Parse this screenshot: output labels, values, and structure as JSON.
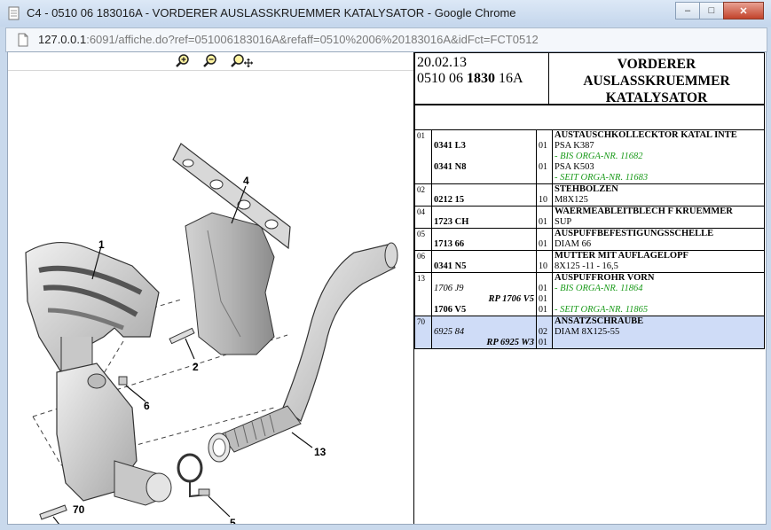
{
  "window": {
    "title": "C4 - 0510 06 183016A - VORDERER AUSLASSKRUEMMER KATALYSATOR - Google Chrome",
    "minimize_label": "–",
    "maximize_label": "□",
    "close_label": "✕"
  },
  "address": {
    "host": "127.0.0.1",
    "rest": ":6091/affiche.do?ref=051006183016A&refaff=0510%2006%20183016A&idFct=FCT0512"
  },
  "toolbar": {
    "icons": [
      "zoom-in-icon",
      "zoom-out-icon",
      "pan-zoom-icon"
    ]
  },
  "diagram": {
    "callouts": [
      "1",
      "2",
      "4",
      "5",
      "6",
      "13",
      "70"
    ]
  },
  "header": {
    "date": "20.02.13",
    "ref_prefix": "0510 06 ",
    "ref_bold": "1830",
    "ref_suffix": " 16A",
    "title_lines": [
      "VORDERER",
      "AUSLASSKRUEMMER",
      "KATALYSATOR"
    ]
  },
  "parts": [
    {
      "pos": "01",
      "refs": [
        "",
        "0341 L3",
        "",
        "0341 N8",
        ""
      ],
      "qtys": [
        "",
        "01",
        "",
        "01",
        ""
      ],
      "descs": [
        "AUSTAUSCHKOLLECKTOR KATAL INTE",
        "PSA K387",
        "- BIS ORGA-NR. 11682",
        "PSA K503",
        "- SEIT ORGA-NR. 11683"
      ]
    },
    {
      "pos": "02",
      "refs": [
        "",
        "0212 15"
      ],
      "qtys": [
        "",
        "10"
      ],
      "descs": [
        "STEHBOLZEN",
        "M8X125"
      ]
    },
    {
      "pos": "04",
      "refs": [
        "",
        "1723 CH"
      ],
      "qtys": [
        "",
        "01"
      ],
      "descs": [
        "WAERMEABLEITBLECH F KRUEMMER",
        "SUP"
      ]
    },
    {
      "pos": "05",
      "refs": [
        "",
        "1713 66"
      ],
      "qtys": [
        "",
        "01"
      ],
      "descs": [
        "AUSPUFFBEFESTIGUNGSSCHELLE",
        "DIAM 66"
      ]
    },
    {
      "pos": "06",
      "refs": [
        "",
        "0341 N5"
      ],
      "qtys": [
        "",
        "10"
      ],
      "descs": [
        "MUTTER MIT AUFLAGELOPF",
        "8X125 -11 - 16,5"
      ]
    },
    {
      "pos": "13",
      "refs": [
        "",
        "1706 J9",
        "RP 1706 V5",
        "1706 V5"
      ],
      "qtys": [
        "",
        "01",
        "01",
        "01"
      ],
      "descs": [
        "AUSPUFFROHR VORN",
        "- BIS ORGA-NR. 11864",
        "",
        "- SEIT ORGA-NR. 11865"
      ]
    },
    {
      "pos": "70",
      "refs": [
        "",
        "6925 84",
        "RP 6925 W3"
      ],
      "qtys": [
        "",
        "02",
        "01"
      ],
      "descs": [
        "ANSATZSCHRAUBE",
        "DIAM 8X125-55",
        ""
      ]
    }
  ]
}
